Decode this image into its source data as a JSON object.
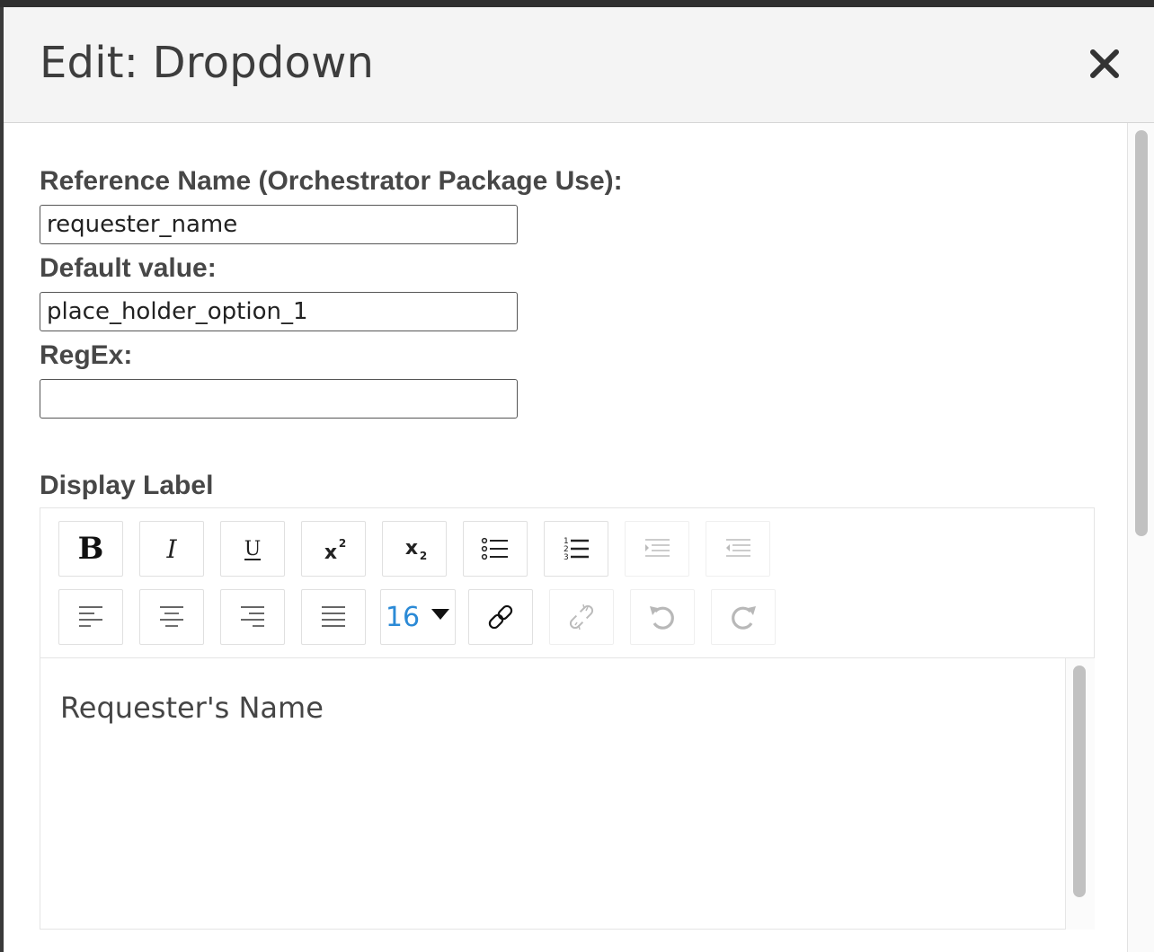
{
  "dialog": {
    "title": "Edit: Dropdown",
    "close_icon": "close-icon"
  },
  "form": {
    "reference_name": {
      "label": "Reference Name (Orchestrator Package Use):",
      "value": "requester_name"
    },
    "default_value": {
      "label": "Default value:",
      "value": "place_holder_option_1"
    },
    "regex": {
      "label": "RegEx:",
      "value": ""
    },
    "display_label": {
      "label": "Display Label",
      "editor_text": "Requester's Name"
    }
  },
  "toolbar": {
    "row1": [
      {
        "icon": "bold-icon",
        "glyph": "B",
        "enabled": true
      },
      {
        "icon": "italic-icon",
        "glyph": "I",
        "enabled": true
      },
      {
        "icon": "underline-icon",
        "glyph": "U",
        "enabled": true
      },
      {
        "icon": "superscript-icon",
        "glyph": "x²",
        "enabled": true
      },
      {
        "icon": "subscript-icon",
        "glyph": "x₂",
        "enabled": true
      },
      {
        "icon": "bullet-list-icon",
        "enabled": true
      },
      {
        "icon": "numbered-list-icon",
        "enabled": true
      },
      {
        "icon": "indent-icon",
        "enabled": false
      },
      {
        "icon": "outdent-icon",
        "enabled": false
      }
    ],
    "row2": [
      {
        "icon": "align-left-icon",
        "enabled": true
      },
      {
        "icon": "align-center-icon",
        "enabled": true
      },
      {
        "icon": "align-right-icon",
        "enabled": true
      },
      {
        "icon": "align-justify-icon",
        "enabled": true
      },
      {
        "icon": "font-size-dropdown",
        "enabled": true
      },
      {
        "icon": "link-icon",
        "enabled": true
      },
      {
        "icon": "unlink-icon",
        "enabled": false
      },
      {
        "icon": "undo-icon",
        "enabled": false
      },
      {
        "icon": "redo-icon",
        "enabled": false
      }
    ],
    "font_size": "16"
  },
  "colors": {
    "font_size_accent": "#2b8ad6",
    "disabled_icon": "#bdbdbd",
    "enabled_icon": "#222222"
  }
}
